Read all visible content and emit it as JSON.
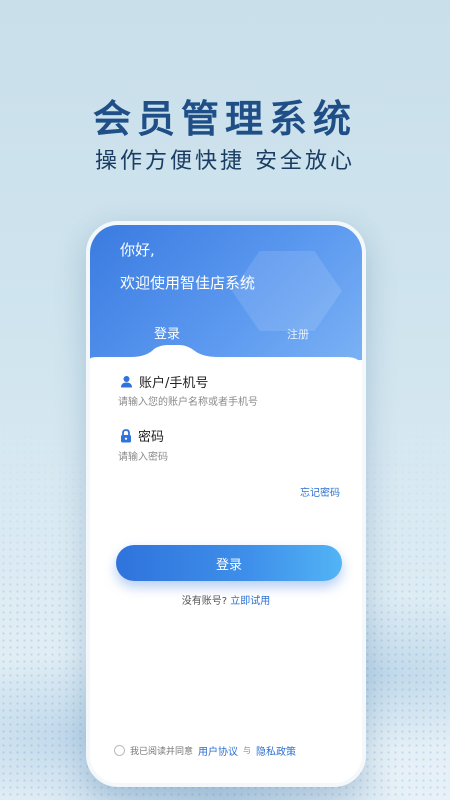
{
  "hero": {
    "title": "会员管理系统",
    "subtitle": "操作方便快捷 安全放心"
  },
  "card": {
    "greeting": "你好,",
    "welcome": "欢迎使用智佳店系统",
    "tabs": {
      "login": "登录",
      "register": "注册"
    },
    "account": {
      "label": "账户/手机号",
      "icon": "user-icon",
      "placeholder": "请输入您的账户名称或者手机号",
      "value": ""
    },
    "password": {
      "label": "密码",
      "icon": "lock-icon",
      "placeholder": "请输入密码",
      "value": ""
    },
    "forgot_password": "忘记密码",
    "login_button": "登录",
    "no_account": "没有账号?",
    "try_now": "立即试用",
    "agreement": {
      "prefix": "我已阅读并同意",
      "user_agreement": "用户协议",
      "and": "与",
      "privacy_policy": "隐私政策"
    }
  },
  "colors": {
    "accent": "#2f73dc",
    "link": "#2d6fd1",
    "headline": "#1f4f86"
  }
}
